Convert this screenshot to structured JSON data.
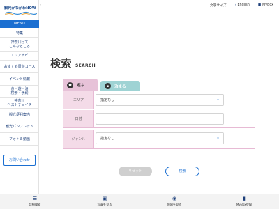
{
  "logo": {
    "text": "観光かながわNOW"
  },
  "menu": {
    "label": "MENU"
  },
  "sidebar": {
    "items": [
      {
        "label": "特集"
      },
      {
        "label": "神奈川って\nこんなところ"
      },
      {
        "label": "エリアナビ"
      },
      {
        "label": "おすすめ周遊コース"
      },
      {
        "label": "イベント情報"
      },
      {
        "label": "食・遊・泊\n（検索・予約）"
      },
      {
        "label": "神奈川\nベストチョイス"
      },
      {
        "label": "観光便利案内"
      },
      {
        "label": "観光パンフレット"
      },
      {
        "label": "フォト＆動画"
      }
    ],
    "contact_label": "お問い合わせ"
  },
  "header": {
    "font_size": "文字サイズ",
    "english": "English",
    "mybox": "MyBox"
  },
  "page": {
    "title_jp": "検索",
    "title_en": "SEARCH"
  },
  "tabs": [
    {
      "label": "遊ぶ",
      "active": true,
      "icon": "play-icon"
    },
    {
      "label": "泊まる",
      "active": false,
      "icon": "hotel-icon"
    }
  ],
  "form": {
    "area": {
      "label": "エリア",
      "value": "指定なし"
    },
    "date": {
      "label": "日付",
      "value": ""
    },
    "genre": {
      "label": "ジャンル",
      "value": "指定なし"
    }
  },
  "buttons": {
    "reset": "リセット",
    "search": "検索"
  },
  "bottombar": [
    {
      "label": "詳細検索",
      "icon": "list-icon"
    },
    {
      "label": "写真を見る",
      "icon": "photo-icon"
    },
    {
      "label": "地図を見る",
      "icon": "map-pin-icon"
    },
    {
      "label": "MyBox登録",
      "icon": "bookmark-icon"
    }
  ],
  "colors": {
    "accent": "#1b6fd1",
    "navy": "#1d3f7a",
    "pink": "#e7c2d8",
    "teal": "#9fd3d4"
  }
}
